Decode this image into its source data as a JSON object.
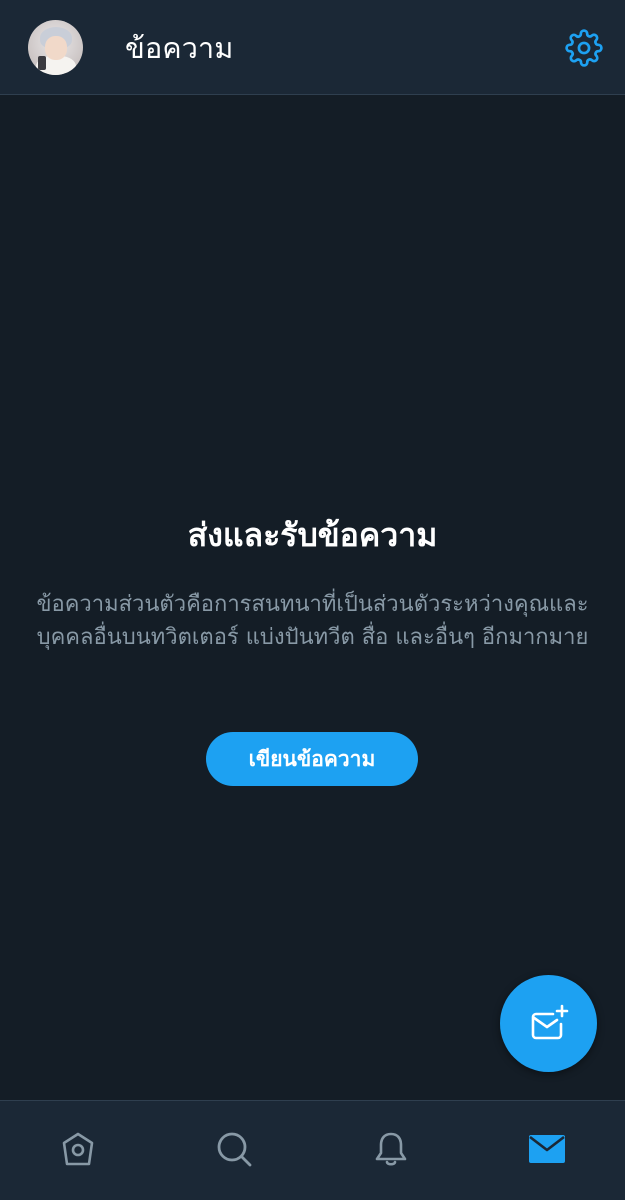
{
  "header": {
    "title": "ข้อความ",
    "avatar": "user-avatar",
    "settings_icon": "gear-icon"
  },
  "empty_state": {
    "title": "ส่งและรับข้อความ",
    "description": "ข้อความส่วนตัวคือการสนทนาที่เป็นส่วนตัวระหว่างคุณและบุคคลอื่นบนทวิตเตอร์ แบ่งปันทวีต สื่อ และอื่นๆ อีกมากมาย",
    "button_label": "เขียนข้อความ"
  },
  "fab": {
    "icon": "new-message-icon"
  },
  "tabbar": {
    "tabs": [
      {
        "icon": "home-icon",
        "active": false
      },
      {
        "icon": "search-icon",
        "active": false
      },
      {
        "icon": "bell-icon",
        "active": false
      },
      {
        "icon": "mail-icon",
        "active": true
      }
    ]
  },
  "colors": {
    "background": "#141d26",
    "header_background": "#1b2836",
    "accent": "#1da1f2",
    "muted_text": "#8899a6",
    "inactive_icon": "#8899a6"
  }
}
